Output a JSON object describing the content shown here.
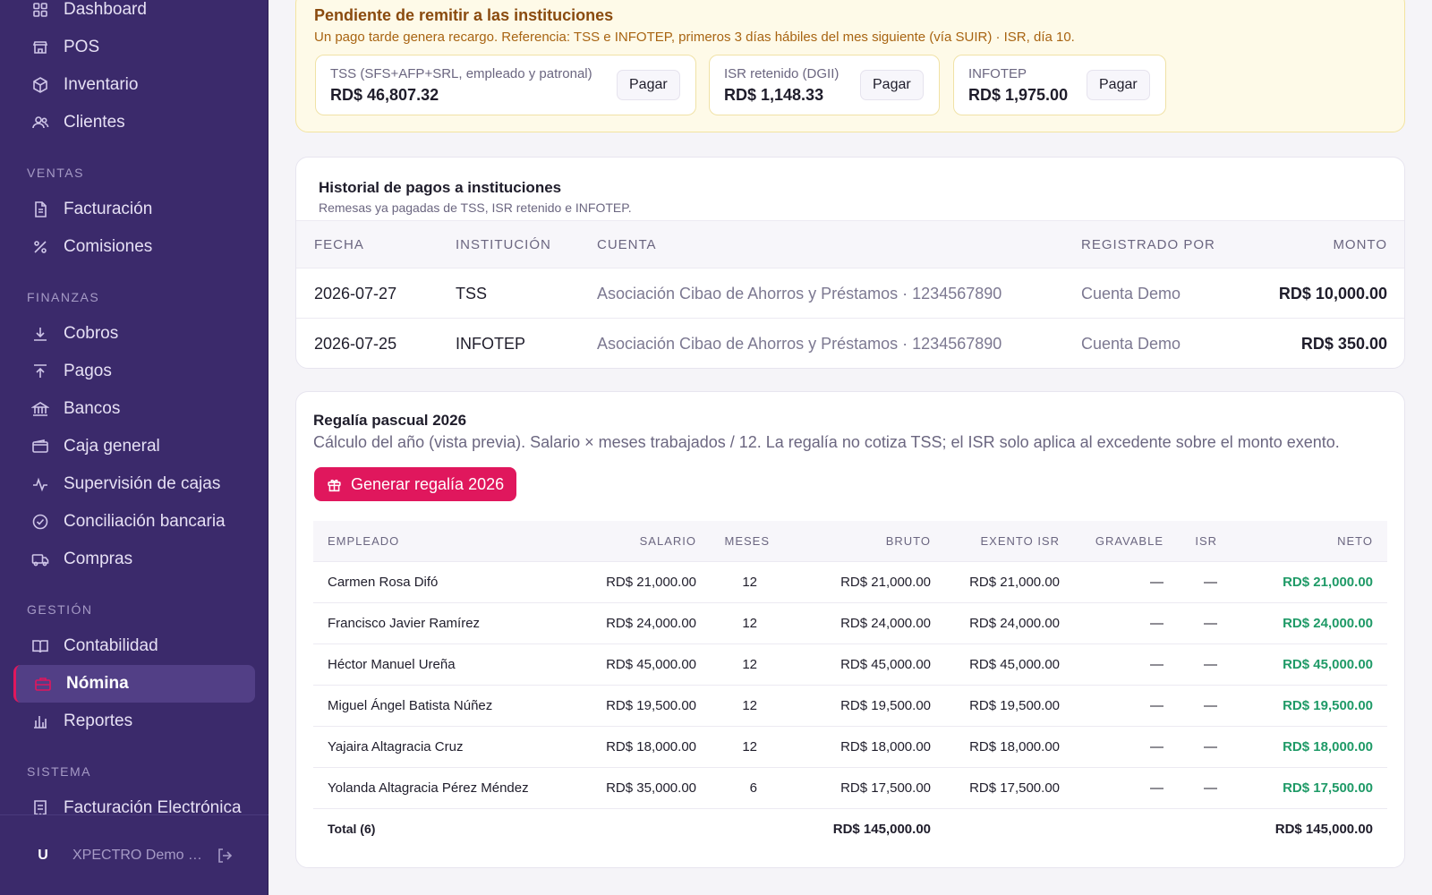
{
  "sidebar": {
    "top_items": [
      {
        "label": "Dashboard",
        "icon": "dashboard-icon"
      },
      {
        "label": "POS",
        "icon": "store-icon"
      },
      {
        "label": "Inventario",
        "icon": "box-icon"
      },
      {
        "label": "Clientes",
        "icon": "users-icon"
      }
    ],
    "sections": [
      {
        "label": "VENTAS",
        "items": [
          {
            "label": "Facturación",
            "icon": "file-icon"
          },
          {
            "label": "Comisiones",
            "icon": "percent-icon"
          }
        ]
      },
      {
        "label": "FINANZAS",
        "items": [
          {
            "label": "Cobros",
            "icon": "arrow-down-icon"
          },
          {
            "label": "Pagos",
            "icon": "arrow-up-icon"
          },
          {
            "label": "Bancos",
            "icon": "bank-icon"
          },
          {
            "label": "Caja general",
            "icon": "wallet-icon"
          },
          {
            "label": "Supervisión de cajas",
            "icon": "activity-icon"
          },
          {
            "label": "Conciliación bancaria",
            "icon": "check-circle-icon"
          },
          {
            "label": "Compras",
            "icon": "truck-icon"
          }
        ]
      },
      {
        "label": "GESTIÓN",
        "items": [
          {
            "label": "Contabilidad",
            "icon": "book-icon"
          },
          {
            "label": "Nómina",
            "icon": "briefcase-icon",
            "active": true
          },
          {
            "label": "Reportes",
            "icon": "bar-chart-icon"
          }
        ]
      },
      {
        "label": "SISTEMA",
        "items": [
          {
            "label": "Facturación Electrónica",
            "icon": "receipt-icon"
          }
        ]
      }
    ],
    "footer": {
      "avatar": "U",
      "name": "XPECTRO Demo S..."
    }
  },
  "pending": {
    "title": "Pendiente de remitir a las instituciones",
    "subtitle": "Un pago tarde genera recargo. Referencia: TSS e INFOTEP, primeros 3 días hábiles del mes siguiente (vía SUIR) · ISR, día 10.",
    "boxes": [
      {
        "label": "TSS (SFS+AFP+SRL, empleado y patronal)",
        "amount": "RD$ 46,807.32",
        "button": "Pagar"
      },
      {
        "label": "ISR retenido (DGII)",
        "amount": "RD$ 1,148.33",
        "button": "Pagar"
      },
      {
        "label": "INFOTEP",
        "amount": "RD$ 1,975.00",
        "button": "Pagar"
      }
    ]
  },
  "history": {
    "title": "Historial de pagos a instituciones",
    "subtitle": "Remesas ya pagadas de TSS, ISR retenido e INFOTEP.",
    "columns": {
      "fecha": "FECHA",
      "institucion": "INSTITUCIÓN",
      "cuenta": "CUENTA",
      "registrado": "REGISTRADO POR",
      "monto": "MONTO"
    },
    "rows": [
      {
        "fecha": "2026-07-27",
        "institucion": "TSS",
        "cuenta": "Asociación Cibao de Ahorros y Préstamos · 1234567890",
        "registrado": "Cuenta Demo",
        "monto": "RD$ 10,000.00"
      },
      {
        "fecha": "2026-07-25",
        "institucion": "INFOTEP",
        "cuenta": "Asociación Cibao de Ahorros y Préstamos · 1234567890",
        "registrado": "Cuenta Demo",
        "monto": "RD$ 350.00"
      }
    ]
  },
  "regalia": {
    "title": "Regalía pascual 2026",
    "subtitle": "Cálculo del año (vista previa). Salario × meses trabajados / 12. La regalía no cotiza TSS; el ISR solo aplica al excedente sobre el monto exento.",
    "button": "Generar regalía 2026",
    "columns": {
      "empleado": "EMPLEADO",
      "salario": "SALARIO",
      "meses": "MESES",
      "bruto": "BRUTO",
      "exento": "EXENTO ISR",
      "gravable": "GRAVABLE",
      "isr": "ISR",
      "neto": "NETO"
    },
    "rows": [
      {
        "empleado": "Carmen Rosa Difó",
        "salario": "RD$ 21,000.00",
        "meses": "12",
        "bruto": "RD$ 21,000.00",
        "exento": "RD$ 21,000.00",
        "gravable": "—",
        "isr": "—",
        "neto": "RD$ 21,000.00"
      },
      {
        "empleado": "Francisco Javier Ramírez",
        "salario": "RD$ 24,000.00",
        "meses": "12",
        "bruto": "RD$ 24,000.00",
        "exento": "RD$ 24,000.00",
        "gravable": "—",
        "isr": "—",
        "neto": "RD$ 24,000.00"
      },
      {
        "empleado": "Héctor Manuel Ureña",
        "salario": "RD$ 45,000.00",
        "meses": "12",
        "bruto": "RD$ 45,000.00",
        "exento": "RD$ 45,000.00",
        "gravable": "—",
        "isr": "—",
        "neto": "RD$ 45,000.00"
      },
      {
        "empleado": "Miguel Ángel Batista Núñez",
        "salario": "RD$ 19,500.00",
        "meses": "12",
        "bruto": "RD$ 19,500.00",
        "exento": "RD$ 19,500.00",
        "gravable": "—",
        "isr": "—",
        "neto": "RD$ 19,500.00"
      },
      {
        "empleado": "Yajaira Altagracia Cruz",
        "salario": "RD$ 18,000.00",
        "meses": "12",
        "bruto": "RD$ 18,000.00",
        "exento": "RD$ 18,000.00",
        "gravable": "—",
        "isr": "—",
        "neto": "RD$ 18,000.00"
      },
      {
        "empleado": "Yolanda Altagracia Pérez Méndez",
        "salario": "RD$ 35,000.00",
        "meses": "6",
        "bruto": "RD$ 17,500.00",
        "exento": "RD$ 17,500.00",
        "gravable": "—",
        "isr": "—",
        "neto": "RD$ 17,500.00"
      }
    ],
    "total": {
      "label": "Total (6)",
      "bruto": "RD$ 145,000.00",
      "neto": "RD$ 145,000.00"
    }
  },
  "colors": {
    "sidebar_bg": "#3b2a6b",
    "accent": "#e0175d",
    "positive": "#1f9a67",
    "warning_bg": "#fefae8"
  }
}
